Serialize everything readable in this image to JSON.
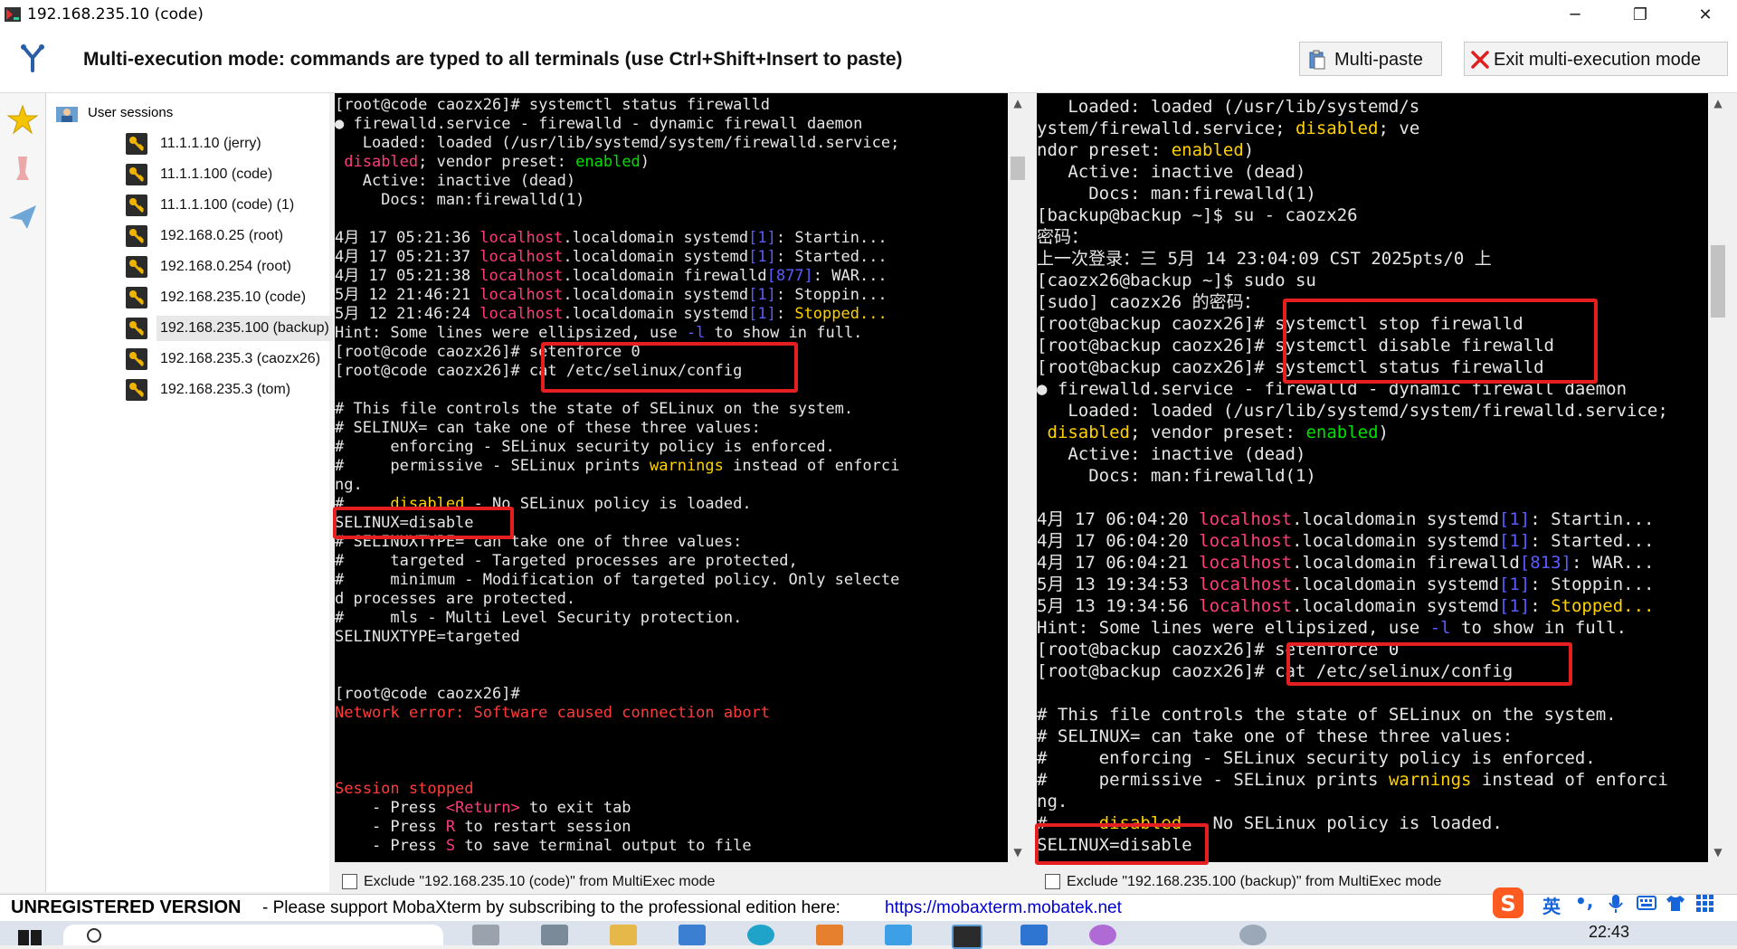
{
  "window": {
    "title": "192.168.235.10 (code)",
    "minimize": "─",
    "maximize": "❐",
    "close": "✕"
  },
  "toolbar": {
    "mode_text": "Multi-execution mode: commands are typed to all terminals (use Ctrl+Shift+Insert to paste)",
    "multipaste_label": "Multi-paste",
    "exit_label": "Exit multi-execution mode"
  },
  "sessions": {
    "root_label": "User sessions",
    "items": [
      "11.1.1.10 (jerry)",
      "11.1.1.100 (code)",
      "11.1.1.100 (code) (1)",
      "192.168.0.25 (root)",
      "192.168.0.254 (root)",
      "192.168.235.10 (code)",
      "192.168.235.100 (backup)",
      "192.168.235.3 (caozx26)",
      "192.168.235.3 (tom)"
    ],
    "selected_index": 6
  },
  "terminal_left": {
    "lines": [
      [
        [
          "[root@code caozx26]# systemctl status firewalld",
          ""
        ]
      ],
      [
        [
          "● firewalld.service - firewalld - dynamic firewall daemon",
          ""
        ]
      ],
      [
        [
          "   Loaded: loaded (/usr/lib/systemd/system/firewalld.service;",
          ""
        ]
      ],
      [
        [
          " ",
          ""
        ],
        [
          "disabled",
          "red"
        ],
        [
          "; vendor preset: ",
          ""
        ],
        [
          "enabled",
          "grn"
        ],
        [
          ")",
          ""
        ]
      ],
      [
        [
          "   Active: inactive (dead)",
          ""
        ]
      ],
      [
        [
          "     Docs: man:firewalld(1)",
          ""
        ]
      ],
      [
        [
          "",
          ""
        ]
      ],
      [
        [
          "4月 17 05:21:36 ",
          ""
        ],
        [
          "localhost",
          "red"
        ],
        [
          ".localdomain systemd",
          ""
        ],
        [
          "[1]",
          "blu"
        ],
        [
          ": Startin...",
          ""
        ]
      ],
      [
        [
          "4月 17 05:21:37 ",
          ""
        ],
        [
          "localhost",
          "red"
        ],
        [
          ".localdomain systemd",
          ""
        ],
        [
          "[1]",
          "blu"
        ],
        [
          ": Started...",
          ""
        ]
      ],
      [
        [
          "4月 17 05:21:38 ",
          ""
        ],
        [
          "localhost",
          "red"
        ],
        [
          ".localdomain firewalld",
          ""
        ],
        [
          "[877]",
          "blu"
        ],
        [
          ": WAR...",
          ""
        ]
      ],
      [
        [
          "5月 12 21:46:21 ",
          ""
        ],
        [
          "localhost",
          "red"
        ],
        [
          ".localdomain systemd",
          ""
        ],
        [
          "[1]",
          "blu"
        ],
        [
          ": Stoppin...",
          ""
        ]
      ],
      [
        [
          "5月 12 21:46:24 ",
          ""
        ],
        [
          "localhost",
          "red"
        ],
        [
          ".localdomain systemd",
          ""
        ],
        [
          "[1]",
          "blu"
        ],
        [
          ": ",
          ""
        ],
        [
          "Stopped...",
          "ylw"
        ]
      ],
      [
        [
          "Hint: Some lines were ellipsized, use ",
          ""
        ],
        [
          "-l",
          "blu"
        ],
        [
          " to show in full.",
          ""
        ]
      ],
      [
        [
          "[root@code caozx26]# setenforce 0",
          ""
        ]
      ],
      [
        [
          "[root@code caozx26]# cat /etc/selinux/config",
          ""
        ]
      ],
      [
        [
          "",
          ""
        ]
      ],
      [
        [
          "# This file controls the state of SELinux on the system.",
          ""
        ]
      ],
      [
        [
          "# SELINUX= can take one of these three values:",
          ""
        ]
      ],
      [
        [
          "#     enforcing - SELinux security policy is enforced.",
          ""
        ]
      ],
      [
        [
          "#     permissive - SELinux prints ",
          ""
        ],
        [
          "warnings",
          "ylw"
        ],
        [
          " instead of enforci",
          ""
        ]
      ],
      [
        [
          "ng.",
          ""
        ]
      ],
      [
        [
          "#     ",
          ""
        ],
        [
          "disabled",
          "ylw"
        ],
        [
          " - No SELinux policy is loaded.",
          ""
        ]
      ],
      [
        [
          "SELINUX=disable",
          ""
        ]
      ],
      [
        [
          "# SELINUXTYPE= can take one of three values:",
          ""
        ]
      ],
      [
        [
          "#     targeted - Targeted processes are protected,",
          ""
        ]
      ],
      [
        [
          "#     minimum - Modification of targeted policy. Only selecte",
          ""
        ]
      ],
      [
        [
          "d processes are protected.",
          ""
        ]
      ],
      [
        [
          "#     mls - Multi Level Security protection.",
          ""
        ]
      ],
      [
        [
          "SELINUXTYPE=targeted",
          ""
        ]
      ],
      [
        [
          "",
          ""
        ]
      ],
      [
        [
          "",
          ""
        ]
      ],
      [
        [
          "[root@code caozx26]#",
          ""
        ]
      ],
      [
        [
          "Network error: Software caused connection abort",
          "err"
        ]
      ],
      [
        [
          "",
          ""
        ]
      ],
      [
        [
          "",
          ""
        ]
      ],
      [
        [
          "",
          ""
        ]
      ],
      [
        [
          "Session stopped",
          "err"
        ]
      ],
      [
        [
          "    - Press ",
          ""
        ],
        [
          "<Return>",
          "red"
        ],
        [
          " to exit tab",
          ""
        ]
      ],
      [
        [
          "    - Press ",
          ""
        ],
        [
          "R",
          "red"
        ],
        [
          " to restart session",
          ""
        ]
      ],
      [
        [
          "    - Press ",
          ""
        ],
        [
          "S",
          "red"
        ],
        [
          " to save terminal output to file",
          ""
        ]
      ]
    ]
  },
  "terminal_right": {
    "lines": [
      [
        [
          "   Loaded: loaded (/usr/lib/systemd/s",
          ""
        ]
      ],
      [
        [
          "ystem/firewalld.service; ",
          ""
        ],
        [
          "disabled",
          "ylw"
        ],
        [
          "; ve",
          ""
        ]
      ],
      [
        [
          "ndor preset: ",
          ""
        ],
        [
          "enabled",
          "ylw"
        ],
        [
          ")",
          ""
        ]
      ],
      [
        [
          "   Active: inactive (dead)",
          ""
        ]
      ],
      [
        [
          "     Docs: man:firewalld(1)",
          ""
        ]
      ],
      [
        [
          "[backup@backup ~]$ su - caozx26",
          ""
        ]
      ],
      [
        [
          "密码：",
          ""
        ]
      ],
      [
        [
          "上一次登录：三 5月 14 23:04:09 CST 2025pts/0 上",
          ""
        ]
      ],
      [
        [
          "[caozx26@backup ~]$ sudo su",
          ""
        ]
      ],
      [
        [
          "[sudo] caozx26 的密码：",
          ""
        ]
      ],
      [
        [
          "[root@backup caozx26]# systemctl stop firewalld",
          ""
        ]
      ],
      [
        [
          "[root@backup caozx26]# systemctl disable firewalld",
          ""
        ]
      ],
      [
        [
          "[root@backup caozx26]# systemctl status firewalld",
          ""
        ]
      ],
      [
        [
          "● firewalld.service - firewalld - dynamic firewall daemon",
          ""
        ]
      ],
      [
        [
          "   Loaded: loaded (/usr/lib/systemd/system/firewalld.service;",
          ""
        ]
      ],
      [
        [
          " ",
          ""
        ],
        [
          "disabled",
          "ylw"
        ],
        [
          "; vendor preset: ",
          ""
        ],
        [
          "enabled",
          "grn"
        ],
        [
          ")",
          ""
        ]
      ],
      [
        [
          "   Active: inactive (dead)",
          ""
        ]
      ],
      [
        [
          "     Docs: man:firewalld(1)",
          ""
        ]
      ],
      [
        [
          "",
          ""
        ]
      ],
      [
        [
          "4月 17 06:04:20 ",
          ""
        ],
        [
          "localhost",
          "red"
        ],
        [
          ".localdomain systemd",
          ""
        ],
        [
          "[1]",
          "blu"
        ],
        [
          ": Startin...",
          ""
        ]
      ],
      [
        [
          "4月 17 06:04:20 ",
          ""
        ],
        [
          "localhost",
          "red"
        ],
        [
          ".localdomain systemd",
          ""
        ],
        [
          "[1]",
          "blu"
        ],
        [
          ": Started...",
          ""
        ]
      ],
      [
        [
          "4月 17 06:04:21 ",
          ""
        ],
        [
          "localhost",
          "red"
        ],
        [
          ".localdomain firewalld",
          ""
        ],
        [
          "[813]",
          "blu"
        ],
        [
          ": WAR...",
          ""
        ]
      ],
      [
        [
          "5月 13 19:34:53 ",
          ""
        ],
        [
          "localhost",
          "red"
        ],
        [
          ".localdomain systemd",
          ""
        ],
        [
          "[1]",
          "blu"
        ],
        [
          ": Stoppin...",
          ""
        ]
      ],
      [
        [
          "5月 13 19:34:56 ",
          ""
        ],
        [
          "localhost",
          "red"
        ],
        [
          ".localdomain systemd",
          ""
        ],
        [
          "[1]",
          "blu"
        ],
        [
          ": ",
          ""
        ],
        [
          "Stopped...",
          "ylw"
        ]
      ],
      [
        [
          "Hint: Some lines were ellipsized, use ",
          ""
        ],
        [
          "-l",
          "blu"
        ],
        [
          " to show in full.",
          ""
        ]
      ],
      [
        [
          "[root@backup caozx26]# setenforce 0",
          ""
        ]
      ],
      [
        [
          "[root@backup caozx26]# cat /etc/selinux/config",
          ""
        ]
      ],
      [
        [
          "",
          ""
        ]
      ],
      [
        [
          "# This file controls the state of SELinux on the system.",
          ""
        ]
      ],
      [
        [
          "# SELINUX= can take one of these three values:",
          ""
        ]
      ],
      [
        [
          "#     enforcing - SELinux security policy is enforced.",
          ""
        ]
      ],
      [
        [
          "#     permissive - SELinux prints ",
          ""
        ],
        [
          "warnings",
          "ylw"
        ],
        [
          " instead of enforci",
          ""
        ]
      ],
      [
        [
          "ng.",
          ""
        ]
      ],
      [
        [
          "#     ",
          ""
        ],
        [
          "disabled",
          "ylw"
        ],
        [
          " - No SELinux policy is loaded.",
          ""
        ]
      ],
      [
        [
          "SELINUX=disable",
          ""
        ]
      ]
    ]
  },
  "exclude": {
    "left_label": "Exclude \"192.168.235.10 (code)\" from MultiExec mode",
    "right_label": "Exclude \"192.168.235.100 (backup)\" from MultiExec mode"
  },
  "statusbar": {
    "unregistered": "UNREGISTERED VERSION",
    "support": "-  Please support MobaXterm by subscribing to the professional edition here:",
    "link": "https://mobaxterm.mobatek.net"
  },
  "ime": {
    "lang": "英",
    "punct": "•,"
  },
  "taskbar": {
    "time": "22:43"
  },
  "colors": {
    "red_box": "#e51f1f",
    "terminal_bg": "#000000",
    "hostname": "#ff3c78",
    "pid": "#5b5bff",
    "warn": "#ffd200",
    "enabled": "#00e000",
    "error": "#ff3b3b"
  }
}
